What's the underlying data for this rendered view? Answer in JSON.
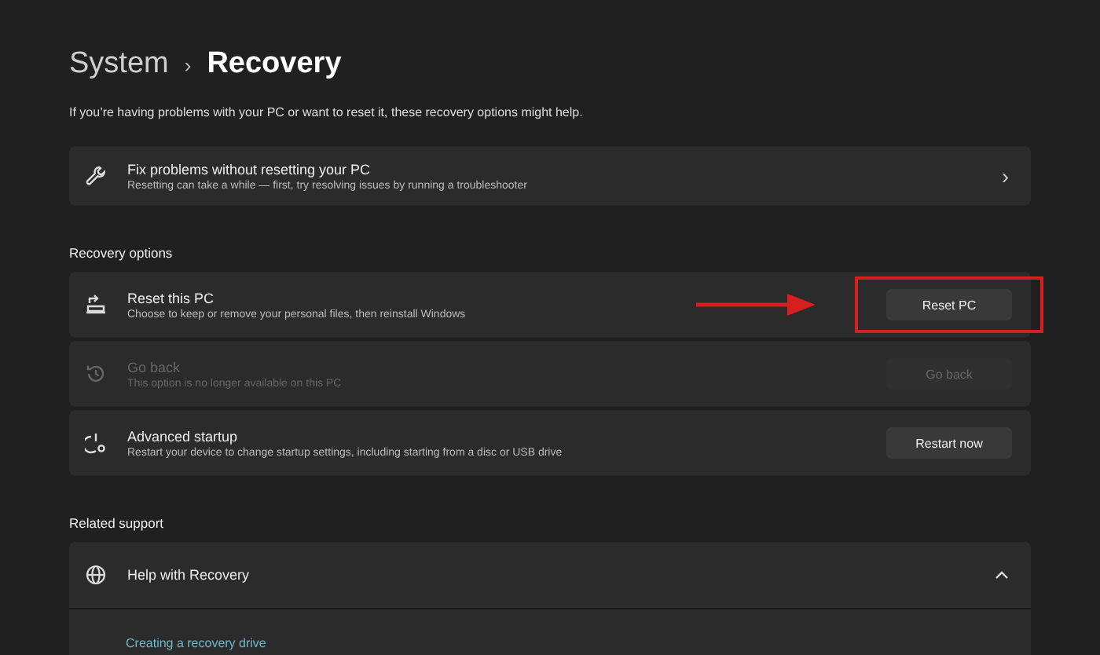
{
  "breadcrumb": {
    "parent": "System",
    "separator": "›",
    "current": "Recovery"
  },
  "description": "If you’re having problems with your PC or want to reset it, these recovery options might help.",
  "fix_card": {
    "title": "Fix problems without resetting your PC",
    "subtitle": "Resetting can take a while — first, try resolving issues by running a troubleshooter",
    "chevron": "›"
  },
  "recovery_options": {
    "heading": "Recovery options",
    "items": [
      {
        "kind": "reset",
        "title": "Reset this PC",
        "subtitle": "Choose to keep or remove your personal files, then reinstall Windows",
        "button": "Reset PC",
        "disabled": false,
        "highlighted": true
      },
      {
        "kind": "goback",
        "title": "Go back",
        "subtitle": "This option is no longer available on this PC",
        "button": "Go back",
        "disabled": true,
        "highlighted": false
      },
      {
        "kind": "advanced",
        "title": "Advanced startup",
        "subtitle": "Restart your device to change startup settings, including starting from a disc or USB drive",
        "button": "Restart now",
        "disabled": false,
        "highlighted": false
      }
    ]
  },
  "related_support": {
    "heading": "Related support",
    "item": {
      "title": "Help with Recovery",
      "expanded": true,
      "links": [
        "Creating a recovery drive"
      ]
    }
  }
}
